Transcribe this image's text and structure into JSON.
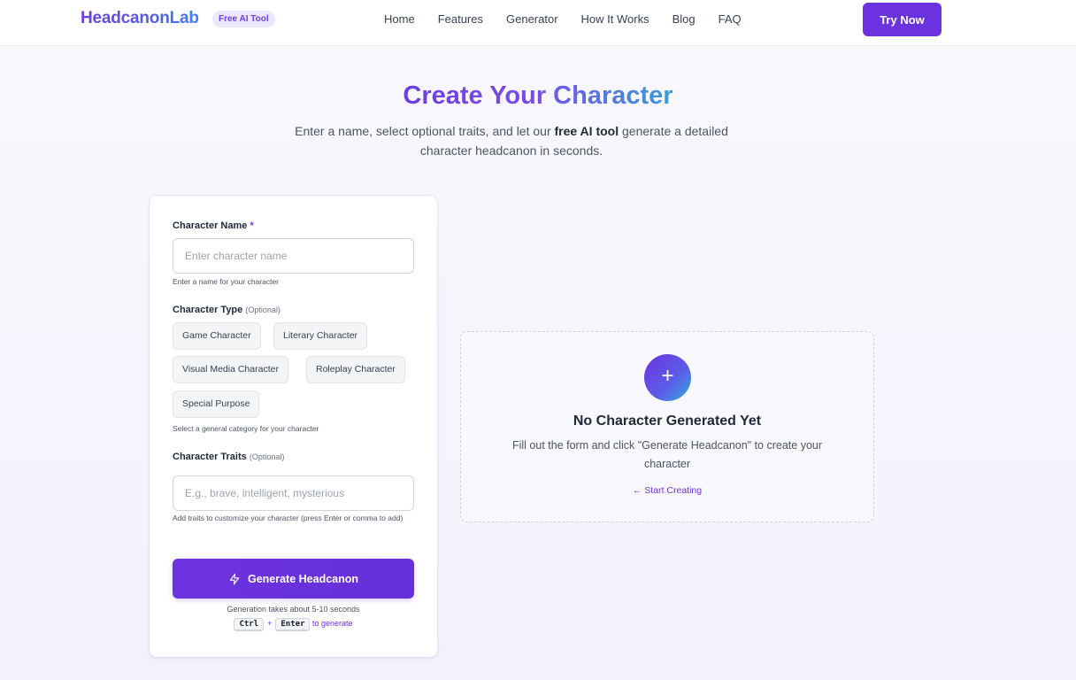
{
  "header": {
    "logo": "HeadcanonLab",
    "badge": "Free AI Tool",
    "nav": [
      "Home",
      "Features",
      "Generator",
      "How It Works",
      "Blog",
      "FAQ"
    ],
    "cta": "Try Now"
  },
  "hero": {
    "title": "Create Your Character",
    "subtitle_pre": "Enter a name, select optional traits, and let our ",
    "subtitle_bold": "free AI tool",
    "subtitle_post": " generate a detailed character headcanon in seconds."
  },
  "form": {
    "name_label": "Character Name",
    "name_required": "*",
    "name_placeholder": "Enter character name",
    "name_hint": "Enter a name for your character",
    "type_label": "Character Type",
    "type_optional": "(Optional)",
    "types": [
      "Game Character",
      "Literary Character",
      "Visual Media Character",
      "Roleplay Character",
      "Special Purpose"
    ],
    "type_hint": "Select a general category for your character",
    "traits_label": "Character Traits",
    "traits_optional": "(Optional)",
    "traits_placeholder": "E.g., brave, intelligent, mysterious",
    "traits_hint": "Add traits to customize your character (press Enter or comma to add)",
    "generate_label": "Generate Headcanon",
    "generate_note": "Generation takes about 5-10 seconds",
    "shortcut_key1": "Ctrl",
    "shortcut_plus": "+",
    "shortcut_key2": "Enter",
    "shortcut_text": "to generate"
  },
  "empty_state": {
    "icon": "plus-icon",
    "title": "No Character Generated Yet",
    "description": "Fill out the form and click \"Generate Headcanon\" to create your character",
    "link": "← Start Creating"
  },
  "colors": {
    "accent": "#6d32e0",
    "gradient_end": "#2fb1dd"
  }
}
